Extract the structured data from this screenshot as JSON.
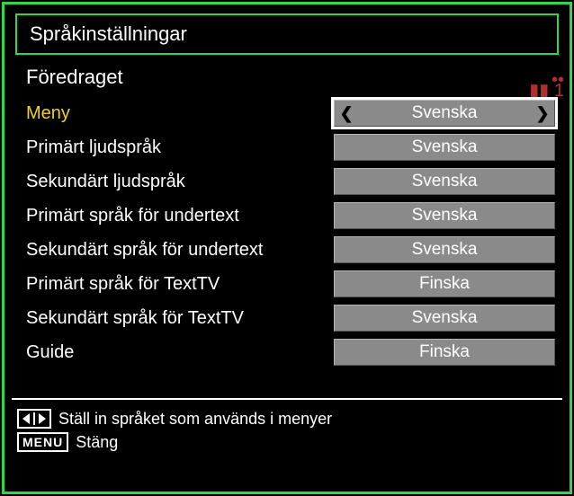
{
  "title": "Språkinställningar",
  "section": "Föredraget",
  "rows": [
    {
      "label": "Meny",
      "value": "Svenska",
      "active": true
    },
    {
      "label": "Primärt ljudspråk",
      "value": "Svenska",
      "active": false
    },
    {
      "label": "Sekundärt ljudspråk",
      "value": "Svenska",
      "active": false
    },
    {
      "label": "Primärt språk för undertext",
      "value": "Svenska",
      "active": false
    },
    {
      "label": "Sekundärt språk för undertext",
      "value": "Svenska",
      "active": false
    },
    {
      "label": "Primärt språk för TextTV",
      "value": "Finska",
      "active": false
    },
    {
      "label": "Sekundärt språk för TextTV",
      "value": "Svenska",
      "active": false
    },
    {
      "label": "Guide",
      "value": "Finska",
      "active": false
    }
  ],
  "footer": {
    "hint1": "Ställ in språket som används i menyer",
    "key2": "MENU",
    "hint2": "Stäng"
  }
}
